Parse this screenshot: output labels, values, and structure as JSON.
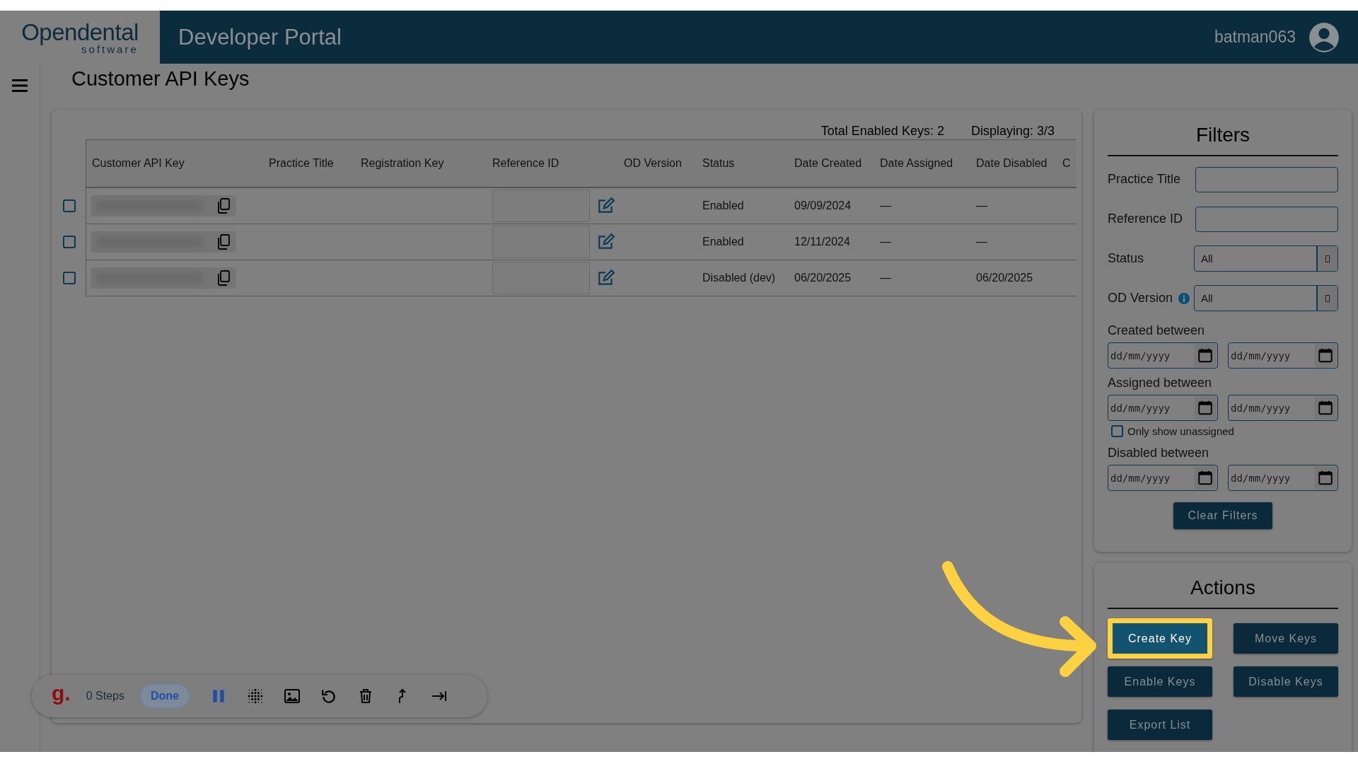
{
  "header": {
    "logo": "Opendental",
    "logo_sub": "software",
    "title": "Developer Portal",
    "user": "batman063"
  },
  "page_title": "Customer API Keys",
  "table": {
    "total": "Total Enabled Keys: 2",
    "displaying": "Displaying: 3/3",
    "columns": [
      "Customer API Key",
      "Practice Title",
      "Registration Key",
      "Reference ID",
      "OD Version",
      "Status",
      "Date Created",
      "Date Assigned",
      "Date Disabled",
      "C"
    ],
    "rows": [
      {
        "checked": false,
        "status": "Enabled",
        "date_created": "09/09/2024",
        "date_assigned": "—",
        "date_disabled": "—"
      },
      {
        "checked": false,
        "status": "Enabled",
        "date_created": "12/11/2024",
        "date_assigned": "—",
        "date_disabled": "—"
      },
      {
        "checked": false,
        "status": "Disabled (dev)",
        "date_created": "06/20/2025",
        "date_assigned": "—",
        "date_disabled": "06/20/2025"
      }
    ]
  },
  "filters": {
    "title": "Filters",
    "fields": [
      {
        "kind": "text",
        "label": "Practice Title"
      },
      {
        "kind": "text",
        "label": "Reference ID"
      },
      {
        "kind": "select",
        "label": "Status",
        "value": "All",
        "info": false
      },
      {
        "kind": "select",
        "label": "OD Version",
        "value": "All",
        "info": true
      },
      {
        "kind": "date_range",
        "label": "Created between",
        "placeholders": [
          "dd/mm/yyyy",
          "dd/mm/yyyy"
        ]
      },
      {
        "kind": "date_range",
        "label": "Assigned between",
        "placeholders": [
          "dd/mm/yyyy",
          "dd/mm/yyyy"
        ]
      },
      {
        "kind": "checkbox",
        "label": "Only show unassigned",
        "checked": false
      },
      {
        "kind": "date_range",
        "label": "Disabled between",
        "placeholders": [
          "dd/mm/yyyy",
          "dd/mm/yyyy"
        ]
      }
    ],
    "button": "Clear Filters"
  },
  "actions": {
    "title": "Actions",
    "buttons": [
      {
        "label": "Create Key",
        "highlighted": true
      },
      {
        "label": "Move Keys",
        "highlighted": false
      },
      {
        "label": "Enable Keys",
        "highlighted": false
      },
      {
        "label": "Disable Keys",
        "highlighted": false
      },
      {
        "label": "Export List",
        "highlighted": false
      }
    ]
  },
  "recorder": {
    "logo": "g.",
    "steps": "0 Steps",
    "done": "Done"
  }
}
